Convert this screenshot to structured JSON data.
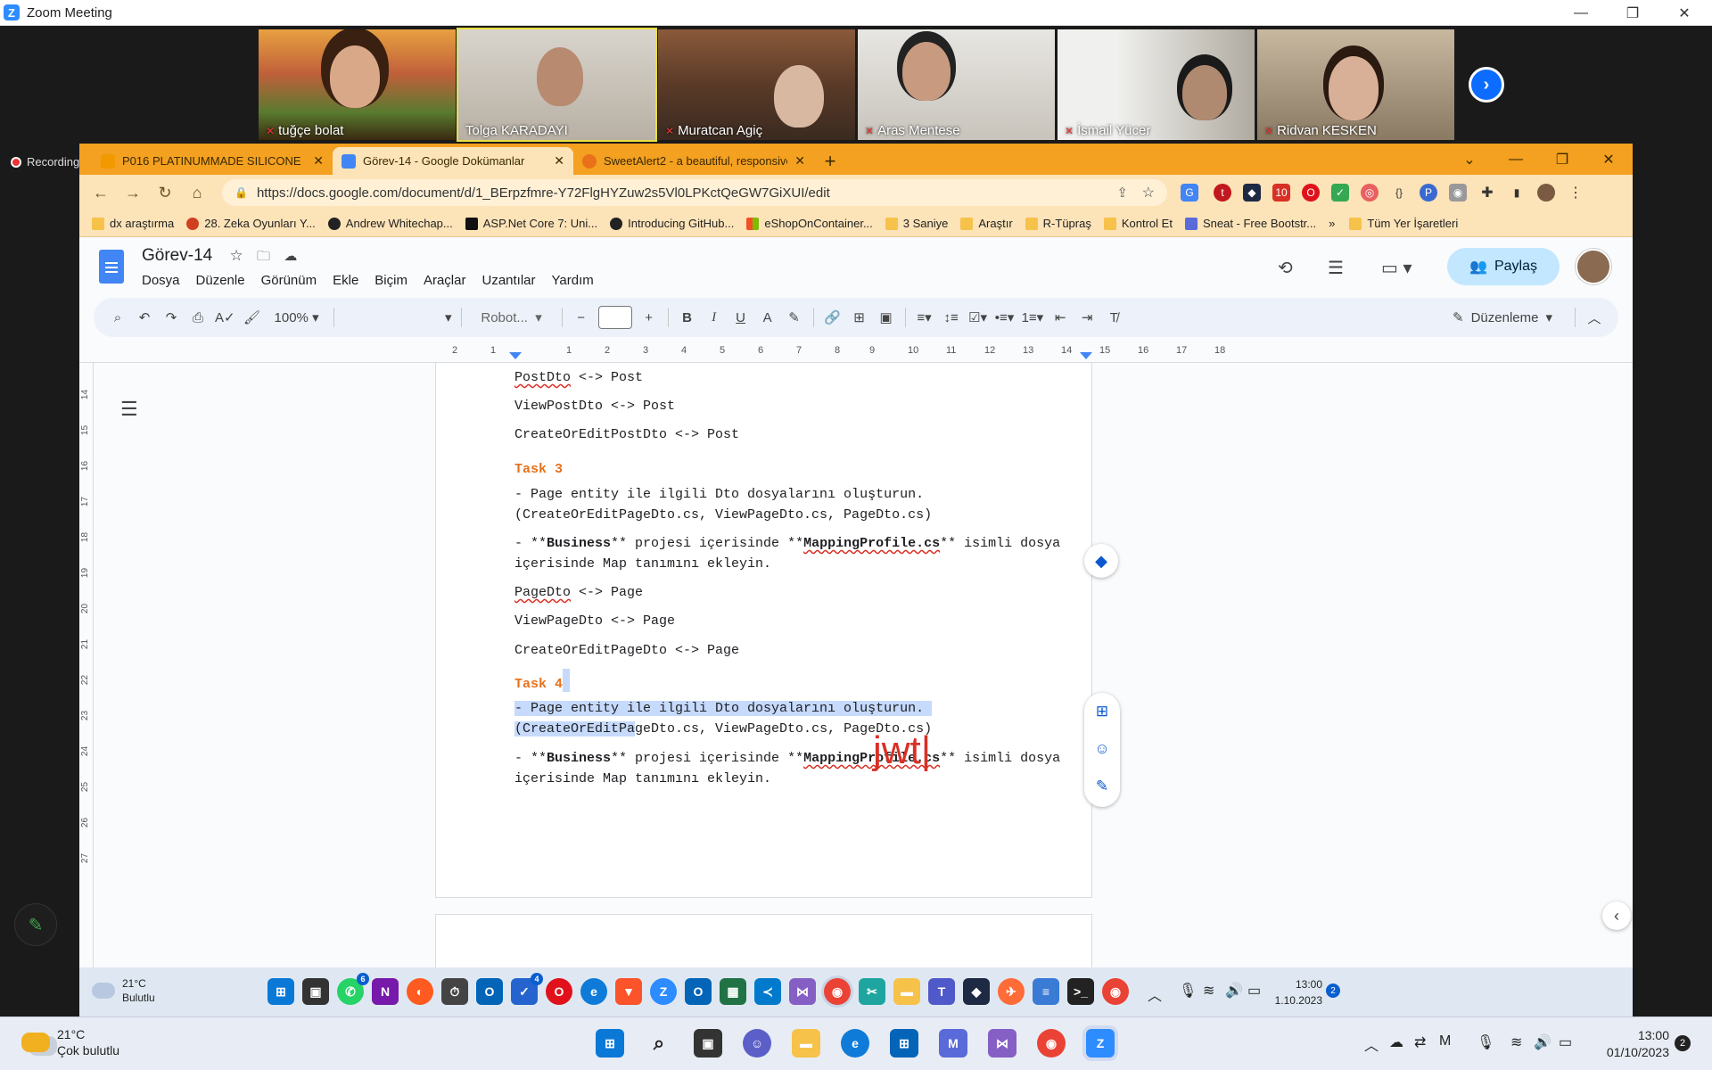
{
  "zoom": {
    "window_title": "Zoom Meeting",
    "recording_label": "Recording",
    "participants": [
      {
        "name": "tuğçe bolat"
      },
      {
        "name": "Tolga KARADAYI"
      },
      {
        "name": "Muratcan Agiç"
      },
      {
        "name": "Aras Mentese"
      },
      {
        "name": "İsmail Yücer"
      },
      {
        "name": "Ridvan KESKEN"
      }
    ]
  },
  "browser": {
    "tabs": [
      {
        "title": "P016 PLATINUMMADE SILICONE",
        "icon_color": "#f29900"
      },
      {
        "title": "Görev-14 - Google Dokümanlar",
        "icon_color": "#4285f4"
      },
      {
        "title": "SweetAlert2 - a beautiful, responsive",
        "icon_color": "#e8711a"
      }
    ],
    "url": "https://docs.google.com/document/d/1_BErpzfmre-Y72FlgHYZuw2s5Vl0LPKctQeGW7GiXUI/edit",
    "bookmarks": [
      {
        "label": "dx araştırma"
      },
      {
        "label": "28. Zeka Oyunları Y..."
      },
      {
        "label": "Andrew Whitechap..."
      },
      {
        "label": "ASP.Net Core 7: Uni..."
      },
      {
        "label": "Introducing GitHub..."
      },
      {
        "label": "eShopOnContainer..."
      },
      {
        "label": "3 Saniye"
      },
      {
        "label": "Araştır"
      },
      {
        "label": "R-Tüpraş"
      },
      {
        "label": "Kontrol Et"
      },
      {
        "label": "Sneat - Free Bootstr..."
      }
    ],
    "bookmarks_more": "»",
    "all_bookmarks": "Tüm Yer İşaretleri"
  },
  "docs": {
    "title": "Görev-14",
    "menu": [
      "Dosya",
      "Düzenle",
      "Görünüm",
      "Ekle",
      "Biçim",
      "Araçlar",
      "Uzantılar",
      "Yardım"
    ],
    "share_label": "Paylaş",
    "zoom_level": "100%",
    "font_name": "Robot...",
    "mode_label": "Düzenleme",
    "ruler_numbers": [
      "2",
      "1",
      "1",
      "2",
      "3",
      "4",
      "5",
      "6",
      "7",
      "8",
      "9",
      "10",
      "11",
      "12",
      "13",
      "14",
      "15",
      "16",
      "17",
      "18"
    ],
    "vruler_numbers": [
      "14",
      "15",
      "16",
      "17",
      "18",
      "19",
      "20",
      "21",
      "22",
      "23",
      "24",
      "25",
      "26",
      "27"
    ],
    "content": {
      "l1a": "PostDto",
      "l1b": " <-> Post",
      "l2": "ViewPostDto <-> Post",
      "l3": "CreateOrEditPostDto <-> Post",
      "task3": "Task 3",
      "t3a": "- Page entity ile ilgili Dto dosyalarını oluşturun.",
      "t3b": "(CreateOrEditPageDto.cs, ViewPageDto.cs, PageDto.cs)",
      "t3c1": "- **",
      "t3c2": "Business",
      "t3c3": "** projesi içerisinde **",
      "t3c4": "MappingProfile.cs",
      "t3c5": "** isimli dosya",
      "t3d": "içerisinde Map tanımını ekleyin.",
      "p1a": "PageDto",
      "p1b": " <-> Page",
      "p2": "ViewPageDto <-> Page",
      "p3": "CreateOrEditPageDto <-> Page",
      "task4": "Task 4",
      "t4a": "- Page entity ile ilgili Dto dosyalarını oluşturun.",
      "t4b1": "(CreateOrEditPa",
      "t4b2": "geDto.cs, ViewPageDto.cs, PageDto.cs)",
      "t4c1": "- **",
      "t4c2": "Business",
      "t4c3": "** projesi içerisinde **",
      "t4c4": "MappingProfile.cs",
      "t4c5": "** isimli dosya",
      "t4d": "içerisinde Map tanımını ekleyin."
    },
    "annotation": "jwt"
  },
  "remote_taskbar": {
    "temp": "21°C",
    "weather": "Bulutlu",
    "time": "13:00",
    "date": "1.10.2023",
    "notif_count": "2",
    "badge_whatsapp": "6",
    "badge_todo": "4"
  },
  "local_taskbar": {
    "temp": "21°C",
    "weather": "Çok bulutlu",
    "time": "13:00",
    "date": "01/10/2023",
    "notif_count": "2"
  }
}
